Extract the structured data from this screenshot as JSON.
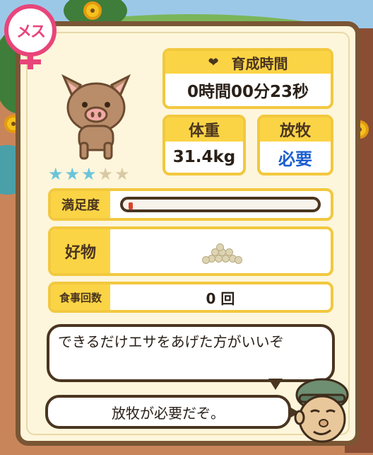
{
  "gender": {
    "label": "メス",
    "color": "#e8457a"
  },
  "animal": {
    "icon": "pig-icon",
    "rank": 3,
    "max_rank": 5
  },
  "stats": {
    "time_label": "育成時間",
    "time_value": "0時間00分23秒",
    "weight_label": "体重",
    "weight_value": "31.4kg",
    "graze_label": "放牧",
    "graze_value": "必要"
  },
  "satisfaction": {
    "label": "満足度",
    "level": 0.02
  },
  "favorite": {
    "label": "好物",
    "icon": "grain-pile-icon"
  },
  "meals": {
    "label": "食事回数",
    "value": "0 回"
  },
  "messages": {
    "tip": "できるだけエサをあげた方がいいぞ",
    "notice": "放牧が必要だぞ。"
  },
  "colors": {
    "accent": "#fbd445",
    "frame": "#7a5634",
    "graze_text": "#1d5fd1"
  }
}
